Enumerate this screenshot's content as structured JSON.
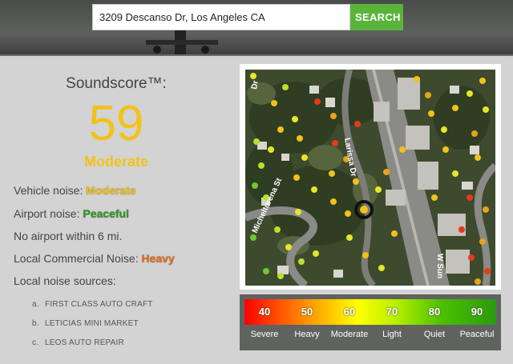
{
  "search": {
    "value": "3209 Descanso Dr, Los Angeles CA",
    "button_label": "SEARCH"
  },
  "score": {
    "title": "Soundscore™:",
    "value": "59",
    "label": "Moderate",
    "color": "#f2c21a"
  },
  "details": {
    "vehicle_label": "Vehicle noise:",
    "vehicle_value": "Moderate",
    "airport_label": "Airport noise:",
    "airport_value": "Peaceful",
    "airport_distance": "No airport within 6 mi.",
    "commercial_label": "Local Commercial Noise:",
    "commercial_value": "Heavy",
    "sources_label": "Local noise sources:"
  },
  "sources": [
    {
      "index": "a.",
      "name": "FIRST CLASS AUTO CRAFT"
    },
    {
      "index": "b.",
      "name": "LETICIAS MINI MARKET"
    },
    {
      "index": "c.",
      "name": "LEOS AUTO REPAIR"
    }
  ],
  "map": {
    "streets": [
      "Larissa Dr",
      "Micheltorena St",
      "W Sun",
      "Dr"
    ]
  },
  "legend": [
    {
      "value": "40",
      "label": "Severe"
    },
    {
      "value": "50",
      "label": "Heavy"
    },
    {
      "value": "60",
      "label": "Moderate"
    },
    {
      "value": "70",
      "label": "Light"
    },
    {
      "value": "80",
      "label": "Quiet"
    },
    {
      "value": "90",
      "label": "Peaceful"
    }
  ],
  "colors": {
    "accent": "#5ab43c",
    "moderate": "#f2c21a",
    "peaceful": "#2e9a22",
    "heavy": "#e66e1c"
  }
}
